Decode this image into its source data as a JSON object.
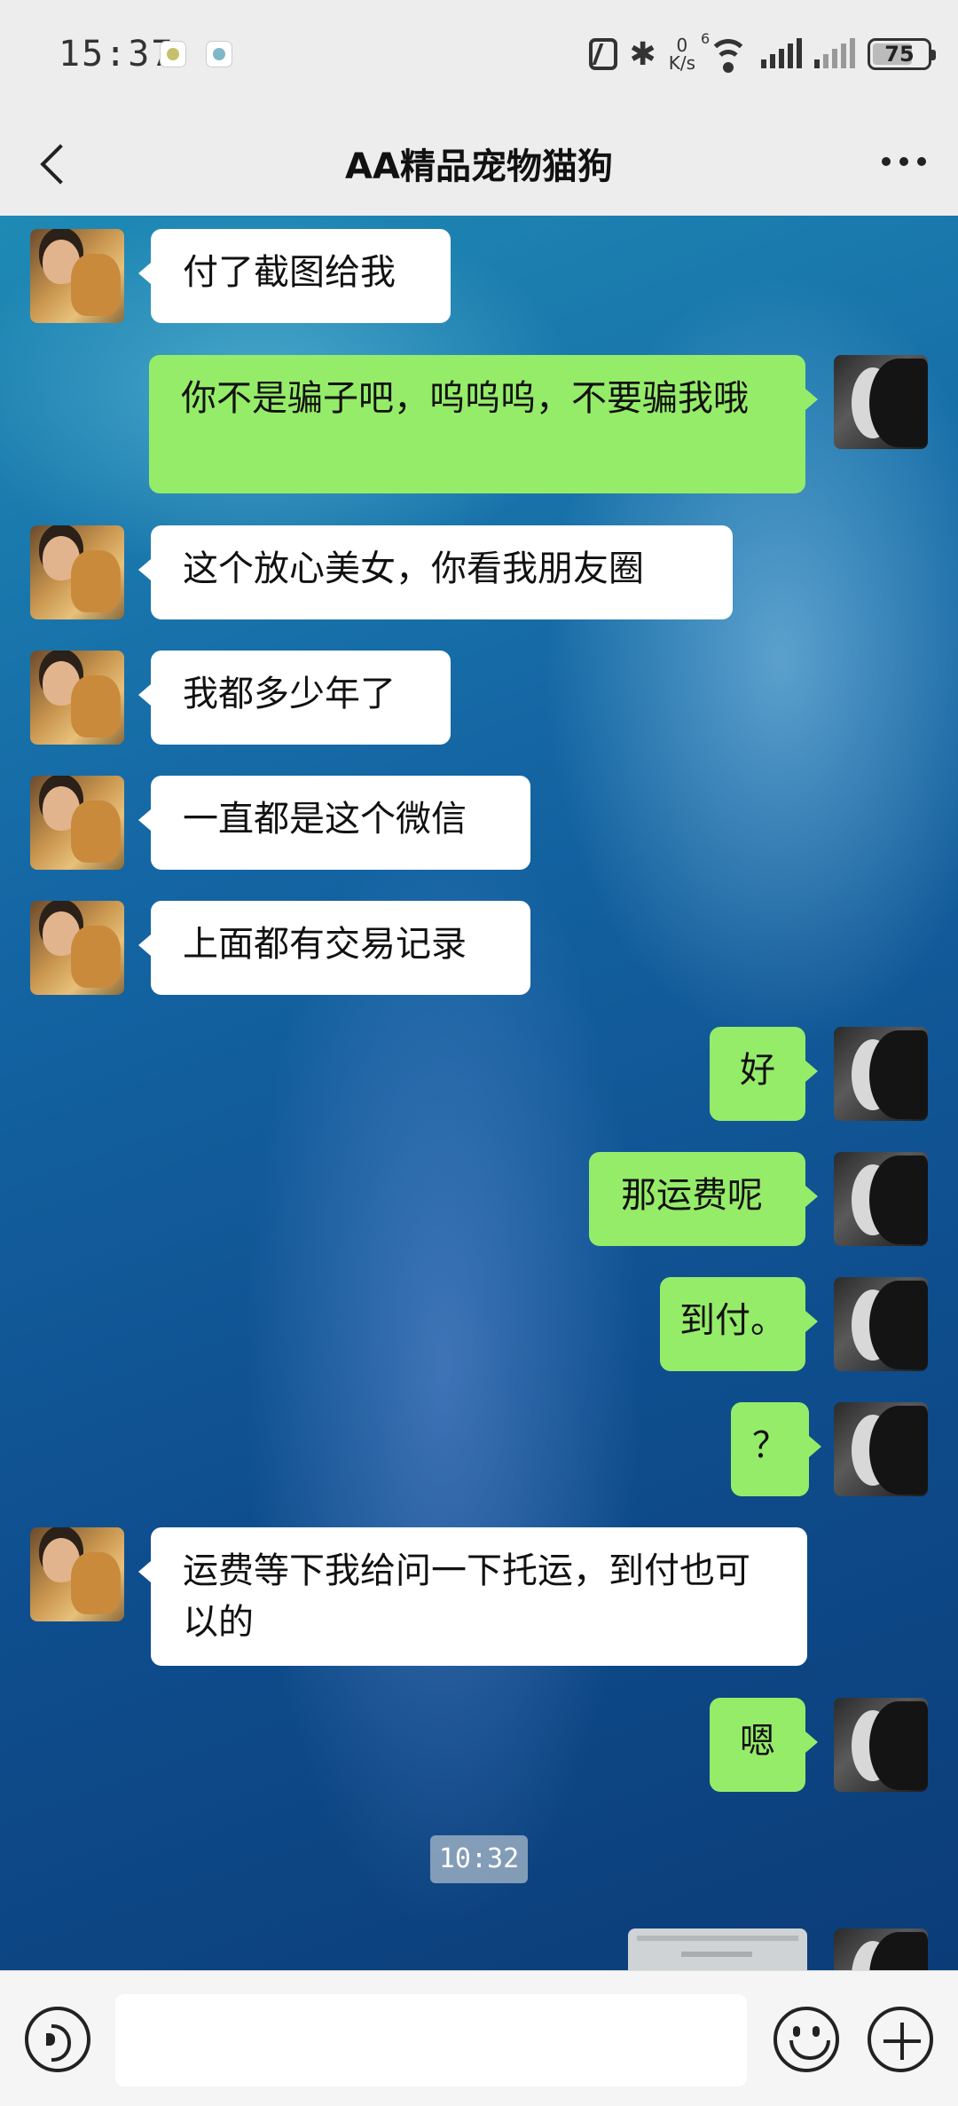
{
  "status_bar": {
    "time": "15:37",
    "bluetooth_symbol": "✱",
    "net_speed_value": "0",
    "net_speed_unit": "K/s",
    "wifi_generation": "6",
    "battery_percent": "75",
    "battery_level": 0.75,
    "icons": [
      "app-notification-icon",
      "app-notification-icon",
      "nfc-icon",
      "bluetooth-icon",
      "wifi-icon",
      "signal-icon",
      "signal-icon",
      "battery-icon"
    ]
  },
  "header": {
    "title": "AA精品宠物猫狗",
    "back_icon": "chevron-left-icon",
    "more_icon": "more-dots-icon"
  },
  "colors": {
    "sent_bubble": "#95ec69",
    "received_bubble": "#ffffff",
    "bar_background": "#ededed"
  },
  "messages": [
    {
      "side": "left",
      "text": "付了截图给我"
    },
    {
      "side": "right",
      "text": "你不是骗子吧，呜呜呜，不要骗我哦"
    },
    {
      "side": "left",
      "text": "这个放心美女，你看我朋友圈"
    },
    {
      "side": "left",
      "text": "我都多少年了"
    },
    {
      "side": "left",
      "text": "一直都是这个微信"
    },
    {
      "side": "left",
      "text": "上面都有交易记录"
    },
    {
      "side": "right",
      "text": "好"
    },
    {
      "side": "right",
      "text": "那运费呢"
    },
    {
      "side": "right",
      "text": "到付。"
    },
    {
      "side": "right",
      "text": "？"
    },
    {
      "side": "left",
      "text": "运费等下我给问一下托运，到付也可以的"
    },
    {
      "side": "right",
      "text": "嗯"
    }
  ],
  "timestamp": "10:32",
  "input_bar": {
    "text_value": "",
    "voice_icon": "voice-icon",
    "emoji_icon": "emoji-icon",
    "plus_icon": "plus-icon"
  }
}
